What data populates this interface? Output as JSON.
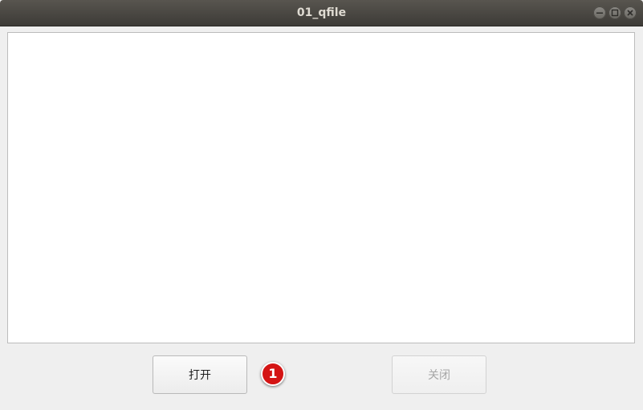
{
  "window": {
    "title": "01_qfile",
    "controls": {
      "minimize_icon": "minimize-icon",
      "maximize_icon": "maximize-icon",
      "close_icon": "close-icon"
    }
  },
  "editor": {
    "content": ""
  },
  "buttons": {
    "open_label": "打开",
    "close_label": "关闭",
    "close_enabled": false
  },
  "annotation": {
    "marker_label": "1",
    "marker_color": "#d41414"
  }
}
